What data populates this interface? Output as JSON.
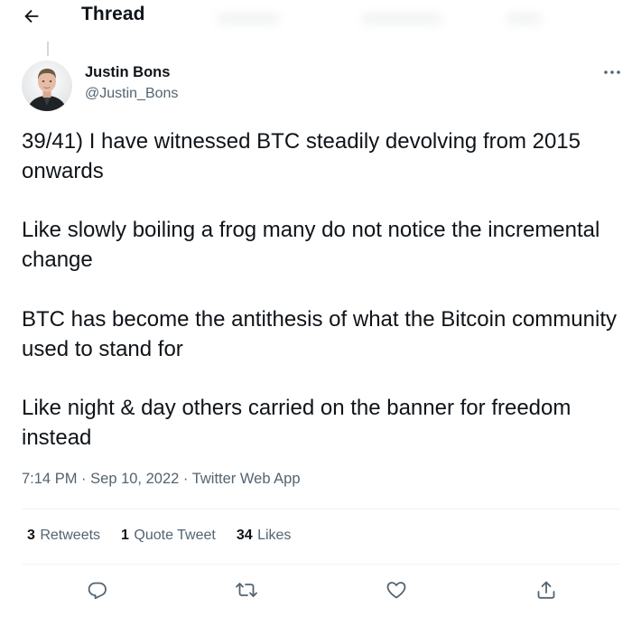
{
  "header": {
    "title": "Thread"
  },
  "author": {
    "display_name": "Justin Bons",
    "handle": "@Justin_Bons"
  },
  "tweet": {
    "paragraphs": [
      "39/41) I have witnessed BTC steadily devolving from 2015 onwards",
      "Like slowly boiling a frog many do not notice the incremental change",
      "BTC has become the antithesis of what the Bitcoin community used to stand for",
      "Like night & day others carried on the banner for freedom instead"
    ],
    "time": "7:14 PM",
    "separator": "·",
    "date": "Sep 10, 2022",
    "source": "Twitter Web App"
  },
  "stats": {
    "retweets_count": "3",
    "retweets_label": "Retweets",
    "quotes_count": "1",
    "quotes_label": "Quote Tweet",
    "likes_count": "34",
    "likes_label": "Likes"
  },
  "icons": {
    "back": "arrow-left-icon",
    "more": "more-horizontal-icon",
    "reply": "reply-icon",
    "retweet": "retweet-icon",
    "like": "heart-icon",
    "share": "share-icon"
  },
  "colors": {
    "text": "#0f1419",
    "secondary": "#536471",
    "divider": "#eff3f4",
    "icon": "#536471"
  }
}
